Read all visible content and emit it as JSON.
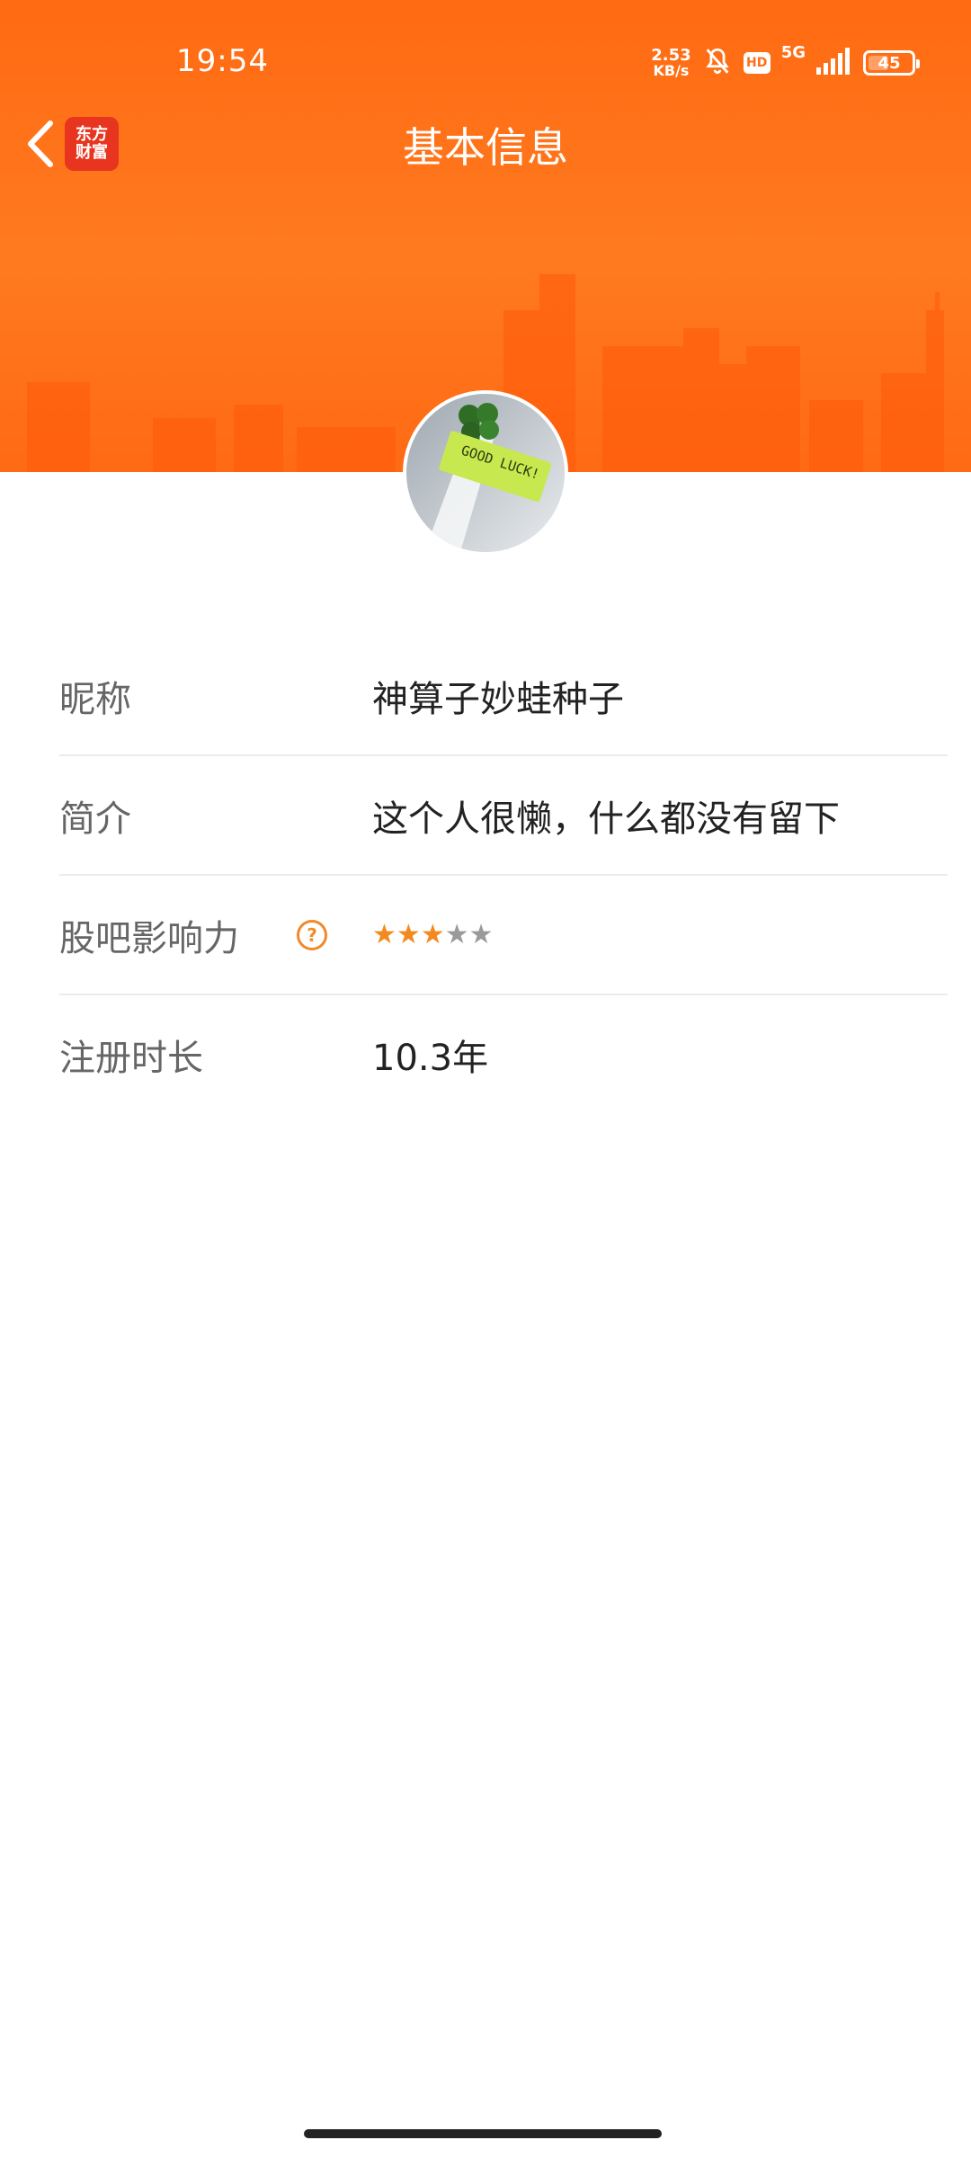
{
  "status_bar": {
    "time": "19:54",
    "net_speed_value": "2.53",
    "net_speed_unit": "KB/s",
    "hd_label": "HD",
    "network": "5G",
    "battery": "45"
  },
  "header": {
    "app_logo_line1": "东方",
    "app_logo_line2": "财富",
    "title": "基本信息",
    "accent_color": "#ff6a12"
  },
  "avatar": {
    "note_text": "GOOD LUCK!"
  },
  "info": {
    "nickname_label": "昵称",
    "nickname_value": "神算子妙蛙种子",
    "bio_label": "简介",
    "bio_value": "这个人很懒，什么都没有留下",
    "influence_label": "股吧影响力",
    "influence_stars": 3,
    "influence_max": 5,
    "registered_label": "注册时长",
    "registered_value": "10.3年"
  },
  "icons": {
    "back": "chevron-left-icon",
    "help": "question-circle-icon",
    "mute": "bell-off-icon",
    "signal": "signal-icon",
    "battery": "battery-icon"
  }
}
